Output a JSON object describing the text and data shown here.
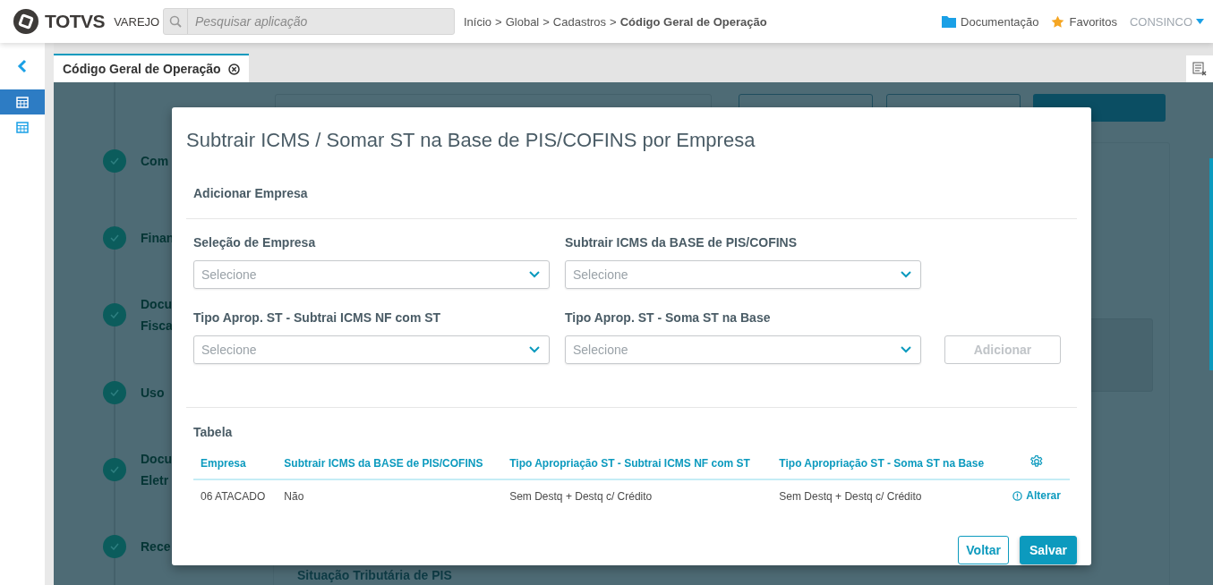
{
  "header": {
    "logo": "TOTVS",
    "logo_sub": "VAREJO",
    "search": {
      "placeholder": "Pesquisar aplicação"
    },
    "breadcrumb_separator": ">",
    "breadcrumb": [
      {
        "label": "Início",
        "current": false
      },
      {
        "label": "Global",
        "current": false
      },
      {
        "label": "Cadastros",
        "current": false
      },
      {
        "label": "Código Geral de Operação",
        "current": true
      }
    ],
    "links": [
      {
        "label": "Documentação",
        "kind": "folder"
      },
      {
        "label": "Favoritos",
        "kind": "star"
      }
    ],
    "user": "CONSINCO"
  },
  "sidebar": {
    "items": [
      {
        "selected": true
      },
      {
        "selected": false
      }
    ]
  },
  "tabs": [
    {
      "label": "Código Geral de Operação",
      "selected": true
    }
  ],
  "background": {
    "steps": [
      {
        "lines": [
          "Com"
        ]
      },
      {
        "lines": [
          "Finan"
        ]
      },
      {
        "lines": [
          "Docu",
          "Fisca"
        ]
      },
      {
        "lines": [
          "Uso"
        ]
      },
      {
        "lines": [
          "Docu",
          "Eletr"
        ]
      },
      {
        "lines": [
          "Rece"
        ]
      }
    ],
    "section_title": "Situação Tributária de PIS"
  },
  "modal": {
    "title": "Subtrair ICMS / Somar ST na Base de PIS/COFINS por Empresa",
    "section": "Adicionar Empresa",
    "fields": [
      {
        "label": "Seleção de Empresa",
        "placeholder": "Selecione"
      },
      {
        "label": "Subtrair ICMS da BASE de PIS/COFINS",
        "placeholder": "Selecione"
      },
      {
        "label": "Tipo Aprop. ST - Subtrai ICMS NF com ST",
        "placeholder": "Selecione"
      },
      {
        "label": "Tipo Aprop. ST - Soma ST na Base",
        "placeholder": "Selecione"
      }
    ],
    "add_button": {
      "label": "Adicionar",
      "disabled": true
    },
    "table": {
      "title": "Tabela",
      "columns": [
        "Empresa",
        "Subtrair ICMS da BASE de PIS/COFINS",
        "Tipo Apropriação ST - Subtrai ICMS NF com ST",
        "Tipo Apropriação ST - Soma ST na Base"
      ],
      "rows": [
        {
          "cells": [
            "06 ATACADO",
            "Não",
            "Sem Destq + Destq c/ Crédito",
            "Sem Destq + Destq c/ Crédito"
          ],
          "action": "Alterar"
        }
      ]
    },
    "buttons": [
      {
        "label": "Voltar",
        "kind": "secondary"
      },
      {
        "label": "Salvar",
        "kind": "primary"
      }
    ]
  }
}
